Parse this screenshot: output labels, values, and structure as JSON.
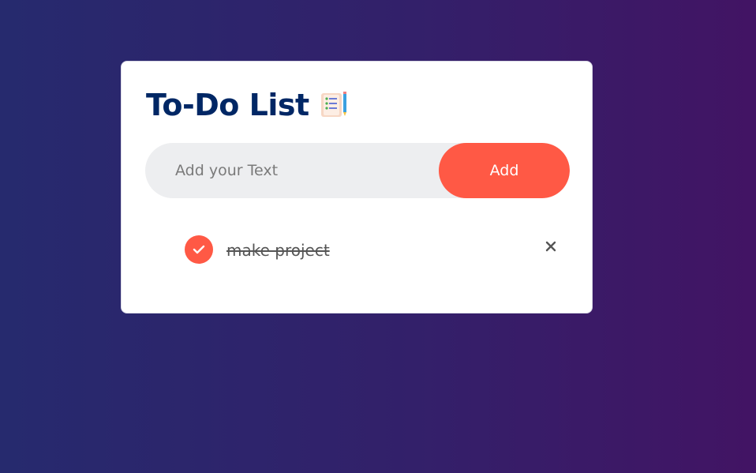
{
  "app": {
    "title": "To-Do List",
    "title_icon": "notepad-checklist-icon"
  },
  "input": {
    "placeholder": "Add your Text",
    "value": ""
  },
  "add_button": {
    "label": "Add"
  },
  "todos": [
    {
      "text": "make project",
      "checked": true,
      "check_icon": "checkmark-icon",
      "remove_icon": "close-icon"
    }
  ],
  "colors": {
    "accent": "#ff5945",
    "title": "#002765",
    "background_start": "#262a6e",
    "background_end": "#421464",
    "input_bg": "#edeef0"
  }
}
